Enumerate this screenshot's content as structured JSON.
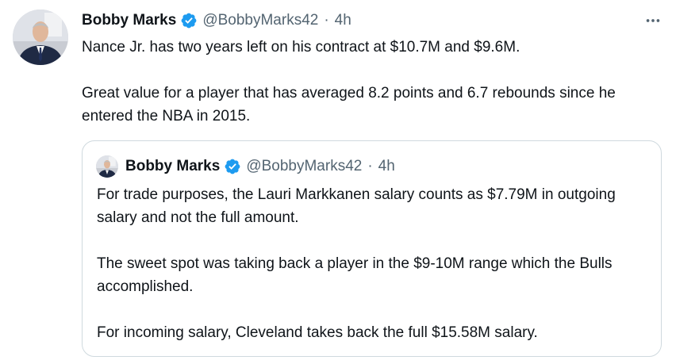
{
  "tweet": {
    "author_name": "Bobby Marks",
    "handle": "@BobbyMarks42",
    "separator": "·",
    "time": "4h",
    "avatar_icon": "user-avatar-icon",
    "verified_icon": "verified-badge-icon",
    "more_icon": "more-options-icon",
    "text": [
      "Nance Jr. has two years left on his contract at $10.7M and $9.6M.",
      "Great value for a player that has averaged 8.2 points and 6.7 rebounds since he entered the NBA in 2015."
    ]
  },
  "quoted_tweet": {
    "author_name": "Bobby Marks",
    "handle": "@BobbyMarks42",
    "separator": "·",
    "time": "4h",
    "avatar_icon": "user-avatar-icon",
    "verified_icon": "verified-badge-icon",
    "text": [
      "For trade purposes, the Lauri Markkanen salary counts as $7.79M in outgoing salary and not the full amount.",
      "The sweet spot was taking back a player in the $9-10M range which the Bulls accomplished.",
      "For incoming salary, Cleveland takes back the full $15.58M salary."
    ]
  },
  "colors": {
    "text_primary": "#0f1419",
    "text_secondary": "#536471",
    "verified_blue": "#1d9bf0",
    "border": "#cfd9de"
  }
}
